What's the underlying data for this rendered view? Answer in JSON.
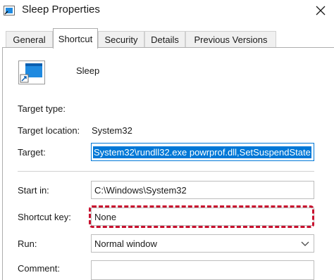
{
  "window": {
    "title": "Sleep Properties"
  },
  "tabs": [
    {
      "label": "General"
    },
    {
      "label": "Shortcut"
    },
    {
      "label": "Security"
    },
    {
      "label": "Details"
    },
    {
      "label": "Previous Versions"
    }
  ],
  "shortcut": {
    "name": "Sleep",
    "target_type_label": "Target type:",
    "target_type_value": "",
    "target_location_label": "Target location:",
    "target_location_value": "System32",
    "target_label": "Target:",
    "target_value": "System32\\rundll32.exe powrprof.dll,SetSuspendState",
    "start_in_label": "Start in:",
    "start_in_value": "C:\\Windows\\System32",
    "shortcut_key_label": "Shortcut key:",
    "shortcut_key_value": "None",
    "run_label": "Run:",
    "run_value": "Normal window",
    "comment_label": "Comment:",
    "comment_value": ""
  },
  "icons": {
    "app": "shortcut-app-icon",
    "close": "close-icon",
    "chevron": "chevron-down-icon"
  },
  "colors": {
    "selection": "#0078d7",
    "highlight_border": "#c8102e"
  }
}
